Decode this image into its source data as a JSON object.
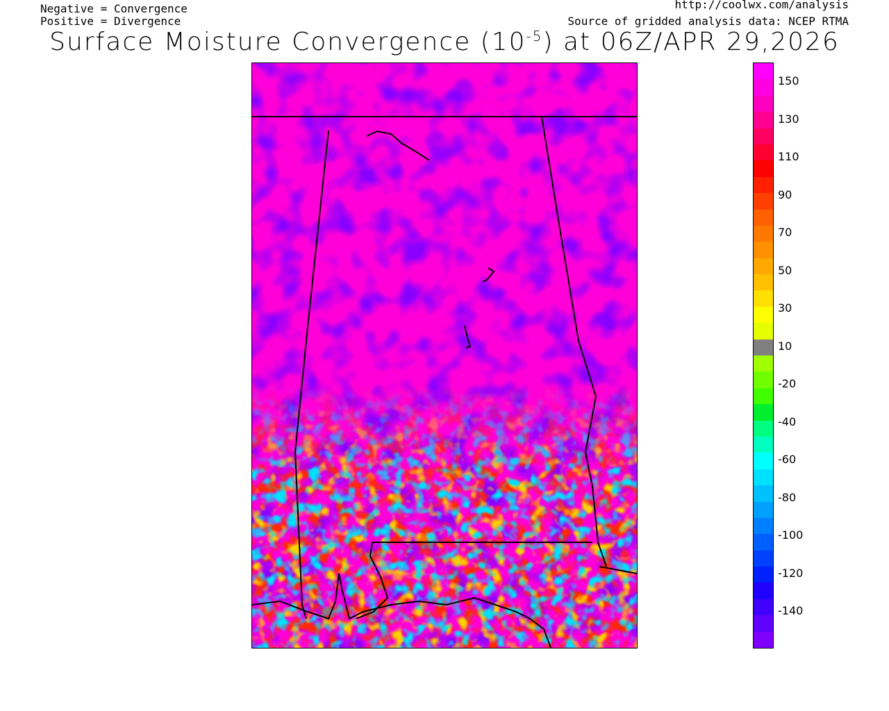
{
  "header": {
    "note_negative": "Negative = Convergence",
    "note_positive": "Positive = Divergence",
    "url": "http://coolwx.com/analysis",
    "source": "Source of gridded analysis data:  NCEP RTMA",
    "title_main": "Surface Moisture Convergence (10",
    "title_exp": "-5",
    "title_tail": ") at 06Z/APR 29,2026"
  },
  "map": {
    "variable": "surface moisture convergence",
    "units": "10^-5",
    "valid_time": "06Z/APR 29,2026",
    "region_outline_color": "#000000",
    "noise_pattern": "mottled field of divergence (magenta/purple) north, mixed convergence and divergence south"
  },
  "colorbar": {
    "labels": [
      "150",
      "130",
      "110",
      "90",
      "70",
      "50",
      "30",
      "10",
      "-20",
      "-40",
      "-60",
      "-80",
      "-100",
      "-120",
      "-140"
    ],
    "colors": [
      "#ff00ff",
      "#ff00e0",
      "#ff00c0",
      "#ff0090",
      "#ff0060",
      "#ff0030",
      "#ff0000",
      "#ff2000",
      "#ff4000",
      "#ff6000",
      "#ff7800",
      "#ff9000",
      "#ffa800",
      "#ffc000",
      "#ffe000",
      "#ffff00",
      "#e6ff00",
      "#808080",
      "#a0ff00",
      "#70ff00",
      "#40ff00",
      "#00f030",
      "#00ff80",
      "#00ffc0",
      "#00ffff",
      "#00e0ff",
      "#00c0ff",
      "#00a0ff",
      "#0080ff",
      "#0060ff",
      "#0040ff",
      "#0020ff",
      "#2000ff",
      "#4000ff",
      "#6000ff",
      "#8000ff"
    ]
  }
}
